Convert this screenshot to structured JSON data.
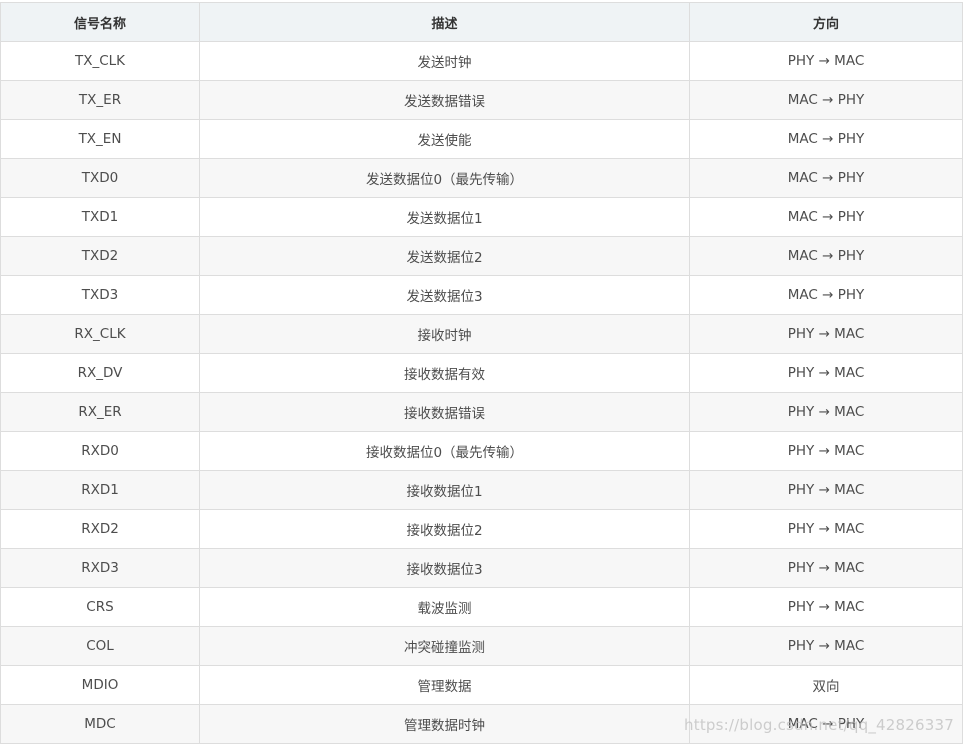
{
  "table": {
    "headers": {
      "name": "信号名称",
      "desc": "描述",
      "dir": "方向"
    },
    "rows": [
      {
        "name": "TX_CLK",
        "desc": "发送时钟",
        "dir": "PHY → MAC"
      },
      {
        "name": "TX_ER",
        "desc": "发送数据错误",
        "dir": "MAC → PHY"
      },
      {
        "name": "TX_EN",
        "desc": "发送使能",
        "dir": "MAC → PHY"
      },
      {
        "name": "TXD0",
        "desc": "发送数据位0（最先传输）",
        "dir": "MAC → PHY"
      },
      {
        "name": "TXD1",
        "desc": "发送数据位1",
        "dir": "MAC → PHY"
      },
      {
        "name": "TXD2",
        "desc": "发送数据位2",
        "dir": "MAC → PHY"
      },
      {
        "name": "TXD3",
        "desc": "发送数据位3",
        "dir": "MAC → PHY"
      },
      {
        "name": "RX_CLK",
        "desc": "接收时钟",
        "dir": "PHY → MAC"
      },
      {
        "name": "RX_DV",
        "desc": "接收数据有效",
        "dir": "PHY → MAC"
      },
      {
        "name": "RX_ER",
        "desc": "接收数据错误",
        "dir": "PHY → MAC"
      },
      {
        "name": "RXD0",
        "desc": "接收数据位0（最先传输）",
        "dir": "PHY → MAC"
      },
      {
        "name": "RXD1",
        "desc": "接收数据位1",
        "dir": "PHY → MAC"
      },
      {
        "name": "RXD2",
        "desc": "接收数据位2",
        "dir": "PHY → MAC"
      },
      {
        "name": "RXD3",
        "desc": "接收数据位3",
        "dir": "PHY → MAC"
      },
      {
        "name": "CRS",
        "desc": "载波监测",
        "dir": "PHY → MAC"
      },
      {
        "name": "COL",
        "desc": "冲突碰撞监测",
        "dir": "PHY → MAC"
      },
      {
        "name": "MDIO",
        "desc": "管理数据",
        "dir": "双向"
      },
      {
        "name": "MDC",
        "desc": "管理数据时钟",
        "dir": "MAC → PHY"
      }
    ]
  },
  "watermark": "https://blog.csdn.net/qq_42826337"
}
